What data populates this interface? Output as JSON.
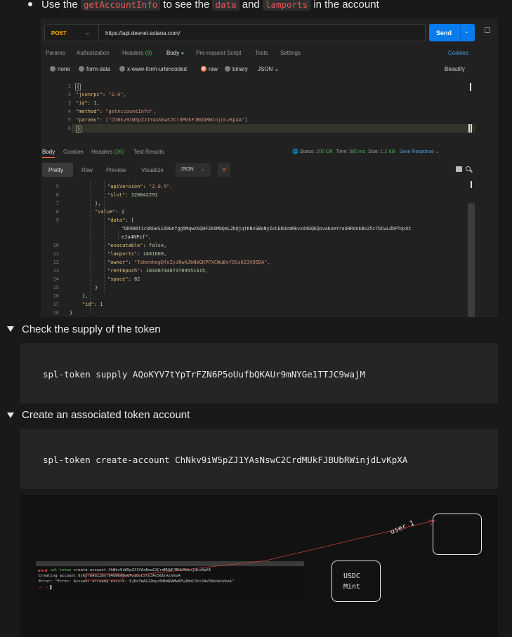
{
  "intro": {
    "prefix": "Use the",
    "code1": "getAccountInfo",
    "mid1": "to see the",
    "code2": "data",
    "mid2": "and",
    "code3": "lamports",
    "suffix": "in the account"
  },
  "postman": {
    "method": "POST",
    "url": "https://api.devnet.solana.com/",
    "send_label": "Send",
    "tabs": [
      "Params",
      "Authorization",
      "Headers",
      "Body",
      "Pre-request Script",
      "Tests",
      "Settings"
    ],
    "headers_count": "(9)",
    "cookies_link": "Cookies",
    "body_types": [
      "none",
      "form-data",
      "x-www-form-urlencoded",
      "raw",
      "binary"
    ],
    "body_format": "JSON",
    "beautify_link": "Beautify",
    "request_lines": [
      {
        "n": "1",
        "text": "{"
      },
      {
        "n": "2",
        "key": "\"jsonrpc\"",
        "val": "\"2.0\","
      },
      {
        "n": "3",
        "key": "\"id\"",
        "val": "1,"
      },
      {
        "n": "4",
        "key": "\"method\"",
        "val": "\"getAccountInfo\","
      },
      {
        "n": "5",
        "key": "\"params\"",
        "val": "[\"ChNkv9iW5pZJ1YAsNswC2CrdMUkFJBUbRWinjdLvKpXA\"]"
      },
      {
        "n": "6",
        "text": "}"
      }
    ],
    "response_tabs": [
      "Body",
      "Cookies",
      "Headers",
      "Test Results"
    ],
    "response_headers_count": "(26)",
    "status_label": "Status:",
    "status_value": "200 OK",
    "time_label": "Time:",
    "time_value": "360 ms",
    "size_label": "Size:",
    "size_value": "1.2 KB",
    "save_response": "Save Response",
    "view_modes": [
      "Pretty",
      "Raw",
      "Preview",
      "Visualize"
    ],
    "response_format": "JSON",
    "response_lines": [
      {
        "n": "5",
        "key": "\"apiVersion\"",
        "val": "\"2.0.5\","
      },
      {
        "n": "6",
        "key": "\"slot\"",
        "val": "320842291"
      },
      {
        "n": "7",
        "text": "},"
      },
      {
        "n": "8",
        "key": "\"value\"",
        "val": "{"
      },
      {
        "n": "9",
        "key": "\"data\"",
        "val": "["
      },
      {
        "n": "",
        "val": "\"DK9N6t1cUKGeS149Gnfgg5MqwXAQHFZk6MbQeL2bQjqtKBzGBoNyZxCE8UxmREvxd4GQKQovaKoeYraUHRdokBx25c7bCwLdbPTqxkt"
      },
      {
        "n": "",
        "val": "eJa4NPzf\","
      },
      {
        "n": "10",
        "key": "\"executable\"",
        "val": "false,"
      },
      {
        "n": "11",
        "key": "\"lamports\"",
        "val": "1461600,"
      },
      {
        "n": "12",
        "key": "\"owner\"",
        "val": "\"TokenkegQfeZyiNwAJbNbGKPFXCWuBvf9Ss623VQ5DA\","
      },
      {
        "n": "13",
        "key": "\"rentEpoch\"",
        "val": "18446744073709551615,"
      },
      {
        "n": "14",
        "key": "\"space\"",
        "val": "82"
      },
      {
        "n": "15",
        "text": "}"
      },
      {
        "n": "16",
        "text": "},"
      },
      {
        "n": "17",
        "key": "\"id\"",
        "val": "1"
      },
      {
        "n": "18",
        "text": "}"
      }
    ]
  },
  "sections": [
    {
      "heading": "Check the supply of the token",
      "code": "spl-token supply AQoKYV7tYpTrFZN6P5oUufbQKAUr9mNYGe1TTJC9wajM"
    },
    {
      "heading": "Create an associated token account",
      "code": "spl-token create-account ChNkv9iW5pZJ1YAsNswC2CrdMUkFJBUbRWinjdLvKpXA"
    }
  ],
  "sketch": {
    "terminal_lines": [
      {
        "prompt": "→  ~",
        "cmd": "spl-token",
        "rest": " create-account ChNkv9iW5pZJ1YAsNswC2CrdMUkFJBUbRWinjdLvKpXA"
      },
      {
        "text": "Creating account 6jKoTmAG1Zmyr84bWGAMw6Fw1BoCStoJAv56bnkcVeoA"
      },
      {
        "text": "Error: \"Error: Account already exists: 6jKoTmAG1Zmyr84bWGAMw6Fw1BoCStoJAv56bnkcVeoA\""
      },
      {
        "prompt": "→  ~",
        "cmd": "▌",
        "rest": ""
      }
    ],
    "mint_label_1": "USDC",
    "mint_label_2": "Mint",
    "arrow_label": "user 1"
  }
}
